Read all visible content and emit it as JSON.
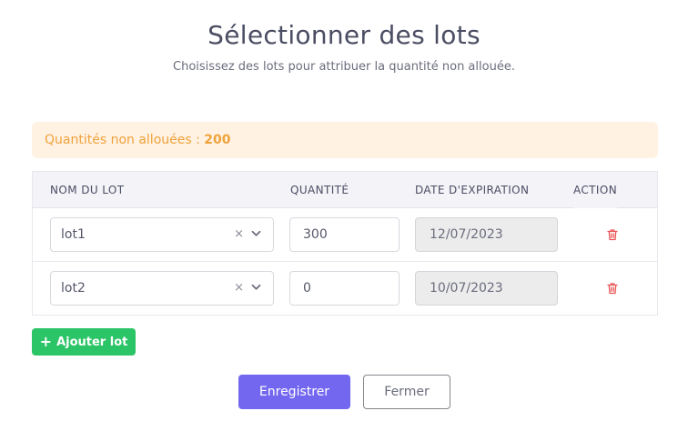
{
  "modal": {
    "title": "Sélectionner des lots",
    "subtitle": "Choisissez des lots pour attribuer la quantité non allouée."
  },
  "alert": {
    "label": "Quantités non allouées : ",
    "value": "200",
    "color": "#f0a23b",
    "background": "#fff2e3"
  },
  "table": {
    "headers": {
      "lot_name": "NOM DU LOT",
      "quantity": "QUANTITÉ",
      "expiry": "DATE D'EXPIRATION",
      "action": "ACTION"
    },
    "rows": [
      {
        "lot": "lot1",
        "quantity": "300",
        "expiry": "12/07/2023",
        "clear_glyph": "×",
        "action_icon": "trash-icon"
      },
      {
        "lot": "lot2",
        "quantity": "0",
        "expiry": "10/07/2023",
        "clear_glyph": "×",
        "action_icon": "trash-icon"
      }
    ]
  },
  "buttons": {
    "add_lot": "Ajouter lot",
    "add_lot_icon": "+",
    "save": "Enregistrer",
    "close": "Fermer"
  },
  "colors": {
    "primary": "#7367f0",
    "success": "#2bc466",
    "danger": "#ea5455"
  }
}
